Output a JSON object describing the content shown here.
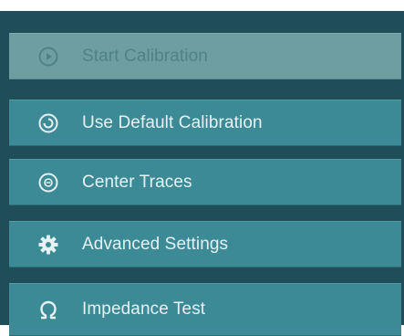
{
  "menu": {
    "items": [
      {
        "label": "Start Calibration",
        "icon": "play-circle-icon",
        "enabled": false
      },
      {
        "label": "Use Default Calibration",
        "icon": "target-circle-icon",
        "enabled": true
      },
      {
        "label": "Center Traces",
        "icon": "center-circle-icon",
        "enabled": true
      },
      {
        "label": "Advanced Settings",
        "icon": "gear-icon",
        "enabled": true
      },
      {
        "label": "Impedance Test",
        "icon": "omega-icon",
        "enabled": true
      }
    ]
  },
  "colors": {
    "panel_background": "#1f4e59",
    "item_background": "#3d8a97",
    "item_disabled_background": "#6f9ea2",
    "item_text": "#e6f1f3",
    "item_disabled_text": "#4f8286"
  }
}
